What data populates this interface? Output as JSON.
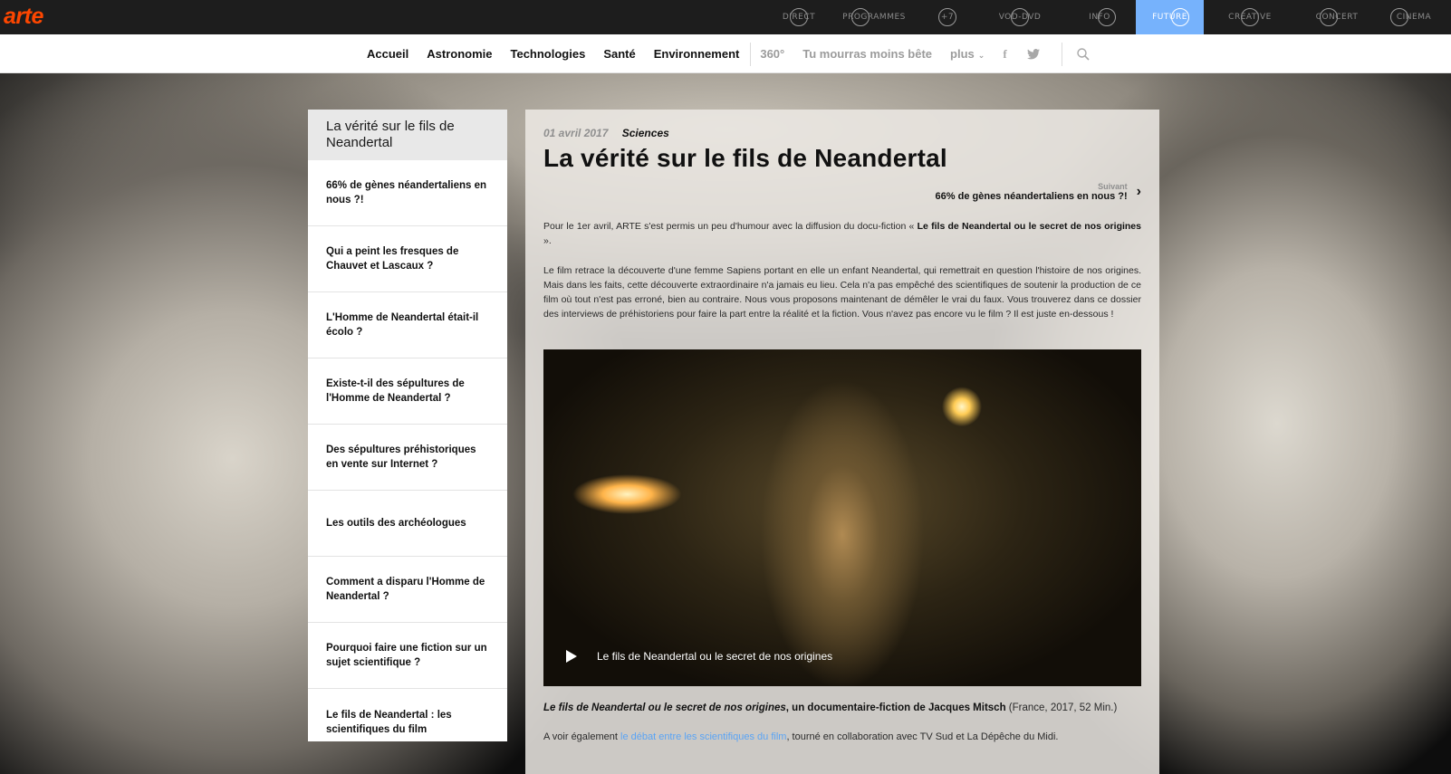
{
  "brand": {
    "logo": "arte",
    "logo_color": "#fd4600"
  },
  "topnav": [
    {
      "label": "DIRECT",
      "active": false
    },
    {
      "label": "PROGRAMMES",
      "active": false
    },
    {
      "label": "+7",
      "active": false
    },
    {
      "label": "VOD-DVD",
      "active": false
    },
    {
      "label": "INFO",
      "active": false
    },
    {
      "label": "FUTURE",
      "active": true
    },
    {
      "label": "CREATIVE",
      "active": false
    },
    {
      "label": "CONCERT",
      "active": false
    },
    {
      "label": "CINEMA",
      "active": false
    }
  ],
  "subnav": {
    "items": [
      "Accueil",
      "Astronomie",
      "Technologies",
      "Santé",
      "Environnement"
    ],
    "extras": [
      "360°",
      "Tu mourras moins bête",
      "plus"
    ],
    "icons": [
      "facebook-icon",
      "twitter-icon",
      "search-icon"
    ]
  },
  "sidebar": {
    "title": "La vérité sur le fils de Neandertal",
    "items": [
      "66% de gènes néandertaliens en nous ?!",
      "Qui a peint les fresques de Chauvet et Lascaux ?",
      "L'Homme de Neandertal était-il écolo ?",
      "Existe-t-il des sépultures de l'Homme de Neandertal ?",
      "Des sépultures préhistoriques en vente sur Internet ?",
      "Les outils des archéologues",
      "Comment a disparu l'Homme de Neandertal ?",
      "Pourquoi faire une fiction sur un sujet scientifique ?",
      "Le fils de Neandertal : les scientifiques du film"
    ]
  },
  "article": {
    "date": "01 avril 2017",
    "category": "Sciences",
    "title": "La vérité sur le fils de Neandertal",
    "next_label": "Suivant",
    "next_title": "66% de gènes néandertaliens en nous ?!",
    "p1_text": "Pour le 1er avril, ARTE s'est permis un peu d'humour avec la diffusion du docu-fiction « ",
    "p1_bold": "Le fils de Neandertal ou le secret de nos origines",
    "p1_end": " ».",
    "p2": "Le film retrace la découverte d'une femme Sapiens portant en elle un enfant Neandertal, qui remettrait en question l'histoire de nos origines. Mais dans les faits, cette découverte extraordinaire n'a jamais eu lieu. Cela n'a pas empêché des scientifiques de soutenir la production de ce film où tout n'est pas erroné, bien au contraire. Nous vous proposons maintenant de démêler le vrai du faux. Vous trouverez dans ce dossier des interviews de préhistoriens pour faire la part entre la réalité et la fiction. Vous n'avez pas encore vu le film ? Il est juste en-dessous !",
    "video_caption": "Le fils de Neandertal ou le secret de nos origines",
    "credit_title": "Le fils de Neandertal ou le secret de nos origines",
    "credit_by": ", un documentaire-fiction de Jacques Mitsch",
    "credit_extra": " (France, 2017, 52 Min.)",
    "also_prefix": "A voir également ",
    "also_link": "le débat entre les scientifiques du film",
    "also_suffix": ", tourné en collaboration avec TV Sud et La Dépêche du Midi."
  },
  "colors": {
    "active_tab": "#76b2fc",
    "link": "#5aa4f5"
  }
}
